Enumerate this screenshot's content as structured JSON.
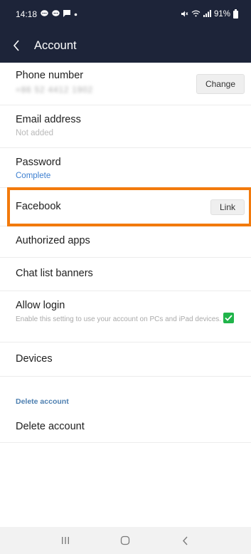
{
  "status_bar": {
    "time": "14:18",
    "battery": "91%"
  },
  "header": {
    "title": "Account"
  },
  "rows": {
    "phone": {
      "title": "Phone number",
      "value": "+86 52 4412 1902",
      "button": "Change"
    },
    "email": {
      "title": "Email address",
      "value": "Not added"
    },
    "password": {
      "title": "Password",
      "value": "Complete"
    },
    "facebook": {
      "title": "Facebook",
      "button": "Link"
    },
    "authorized_apps": {
      "title": "Authorized apps"
    },
    "chat_list_banners": {
      "title": "Chat list banners"
    },
    "allow_login": {
      "title": "Allow login",
      "description": "Enable this setting to use your account on PCs and iPad devices.",
      "checked": true
    },
    "devices": {
      "title": "Devices"
    }
  },
  "delete_section": {
    "label": "Delete account",
    "item": "Delete account"
  },
  "colors": {
    "header_bg": "#1d2439",
    "highlight": "#f27a0c",
    "checkbox": "#20b44a",
    "link_blue": "#3d7fd0"
  }
}
